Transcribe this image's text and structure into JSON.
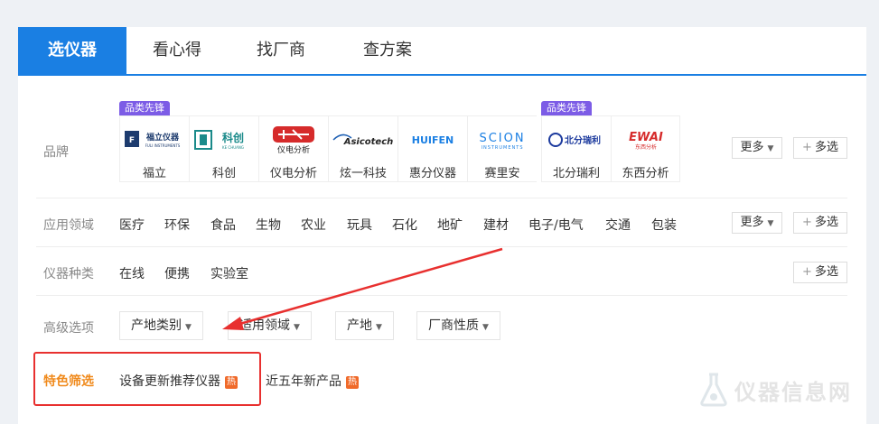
{
  "tabs": [
    {
      "label": "选仪器",
      "active": true
    },
    {
      "label": "看心得",
      "active": false
    },
    {
      "label": "找厂商",
      "active": false
    },
    {
      "label": "查方案",
      "active": false
    }
  ],
  "brand_row": {
    "label": "品牌",
    "pin_tag": "品类先锋",
    "brands": [
      {
        "name": "福立",
        "logo_text": "福立仪器",
        "logo_sub": "FULI INSTRUMENTS",
        "pinned": true
      },
      {
        "name": "科创",
        "logo_text": "科创",
        "logo_sub": "KE CHUANG",
        "pinned": false
      },
      {
        "name": "仪电分析",
        "logo_text": "仪电分析",
        "logo_sub": "",
        "pinned": false
      },
      {
        "name": "炫一科技",
        "logo_text": "Asicotech",
        "logo_sub": "",
        "pinned": false
      },
      {
        "name": "惠分仪器",
        "logo_text": "HUIFEN",
        "logo_sub": "",
        "pinned": false
      },
      {
        "name": "赛里安",
        "logo_text": "SCION",
        "logo_sub": "INSTRUMENTS",
        "pinned": false
      },
      {
        "name": "北分瑞利",
        "logo_text": "北分瑞利",
        "logo_sub": "",
        "pinned": true
      },
      {
        "name": "东西分析",
        "logo_text": "EWAI",
        "logo_sub": "东西分析",
        "pinned": false
      }
    ],
    "more_label": "更多",
    "multi_label": "多选"
  },
  "field_row": {
    "label": "应用领域",
    "options": [
      "医疗",
      "环保",
      "食品",
      "生物",
      "农业",
      "玩具",
      "石化",
      "地矿",
      "建材",
      "电子/电气",
      "交通",
      "包装"
    ],
    "more_label": "更多",
    "multi_label": "多选"
  },
  "type_row": {
    "label": "仪器种类",
    "options": [
      "在线",
      "便携",
      "实验室"
    ],
    "multi_label": "多选"
  },
  "advanced_row": {
    "label": "高级选项",
    "dropdowns": [
      "产地类别",
      "适用领域",
      "产地",
      "厂商性质"
    ]
  },
  "feature_row": {
    "label": "特色筛选",
    "items": [
      {
        "label": "设备更新推荐仪器",
        "badge": "热"
      },
      {
        "label": "近五年新产品",
        "badge": "热"
      }
    ]
  },
  "watermark": {
    "text": "仪器信息网"
  },
  "colors": {
    "accent": "#1a7fe3",
    "feature_label": "#f08a1c",
    "hot_badge": "#f06a2a",
    "pin_tag": "#7c5ce6",
    "annotation": "#e8302f"
  }
}
